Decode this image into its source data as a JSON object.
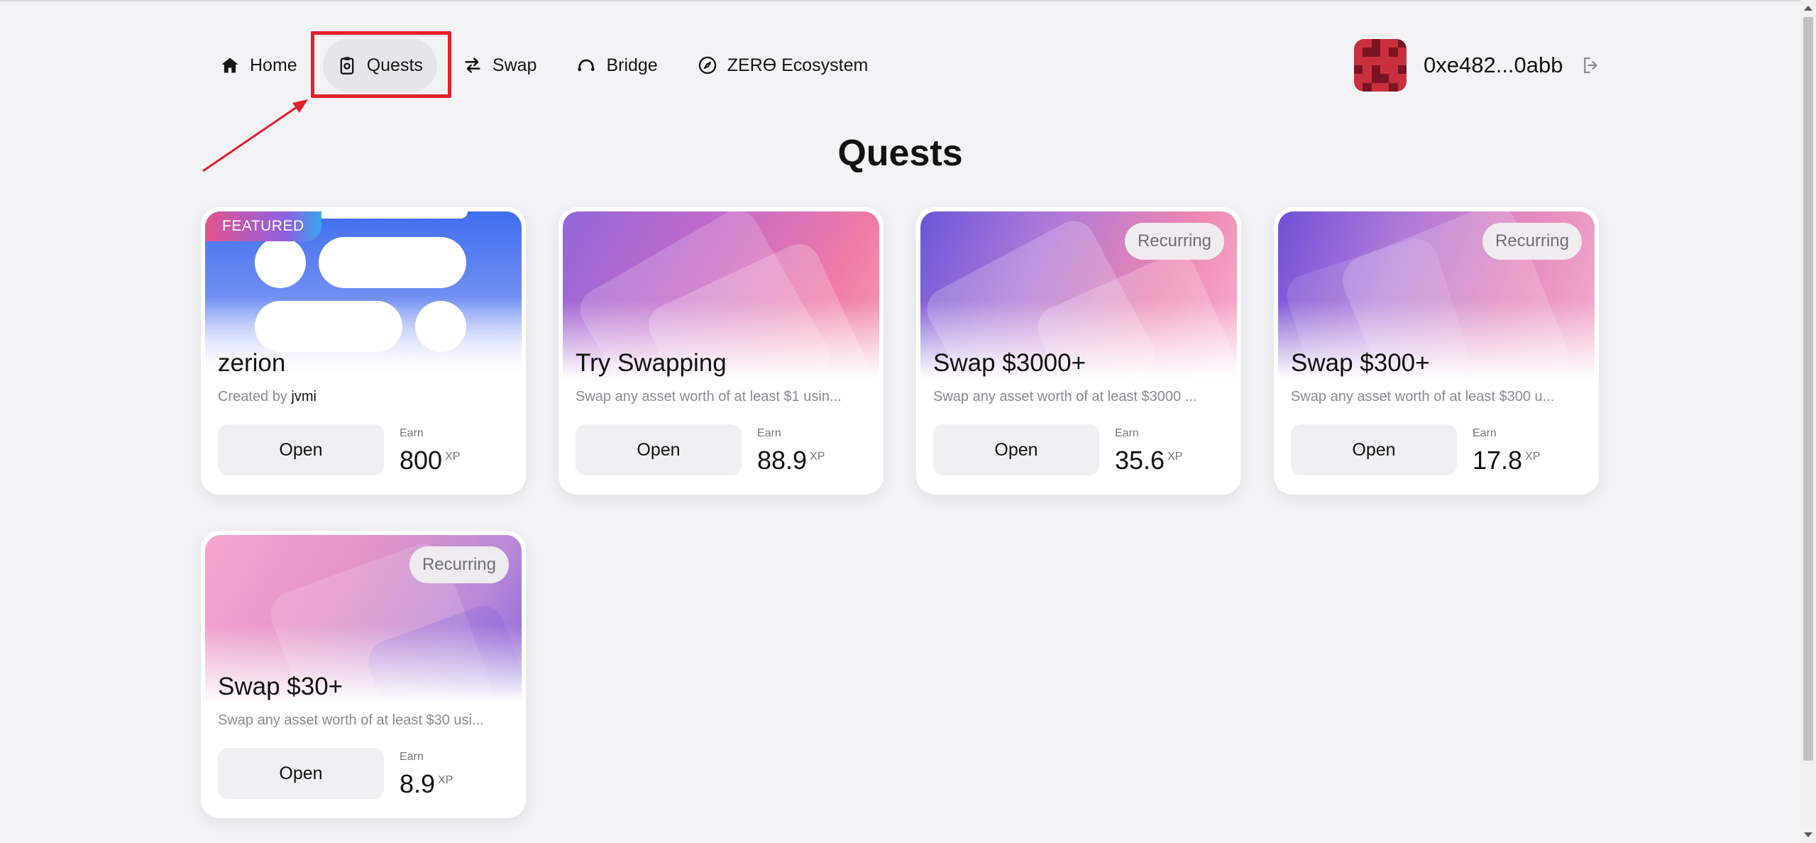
{
  "nav": {
    "items": [
      {
        "label": "Home",
        "icon": "home-icon"
      },
      {
        "label": "Quests",
        "icon": "clipboard-icon",
        "active": true
      },
      {
        "label": "Swap",
        "icon": "swap-arrows-icon"
      },
      {
        "label": "Bridge",
        "icon": "bridge-icon"
      },
      {
        "label": "ZERϴ Ecosystem",
        "icon": "compass-icon"
      }
    ]
  },
  "account": {
    "address": "0xe482...0abb",
    "logout_icon": "logout-icon"
  },
  "page": {
    "title": "Quests"
  },
  "cards": [
    {
      "title": "zerion",
      "featured_label": "FEATURED",
      "created_by_prefix": "Created by",
      "creator": "jvmi",
      "open_label": "Open",
      "earn_label": "Earn",
      "earn_value": "800",
      "unit": "XP"
    },
    {
      "title": "Try Swapping",
      "desc": "Swap any asset worth of at least $1 usin...",
      "open_label": "Open",
      "earn_label": "Earn",
      "earn_value": "88.9",
      "unit": "XP"
    },
    {
      "title": "Swap $3000+",
      "badge": "Recurring",
      "desc": "Swap any asset worth of at least $3000 ...",
      "open_label": "Open",
      "earn_label": "Earn",
      "earn_value": "35.6",
      "unit": "XP"
    },
    {
      "title": "Swap $300+",
      "badge": "Recurring",
      "desc": "Swap any asset worth of at least $300 u...",
      "open_label": "Open",
      "earn_label": "Earn",
      "earn_value": "17.8",
      "unit": "XP"
    },
    {
      "title": "Swap $30+",
      "badge": "Recurring",
      "desc": "Swap any asset worth of at least $30 usi...",
      "open_label": "Open",
      "earn_label": "Earn",
      "earn_value": "8.9",
      "unit": "XP"
    }
  ],
  "colors": {
    "highlight": "#e4202a",
    "background": "#f3f3f5"
  }
}
